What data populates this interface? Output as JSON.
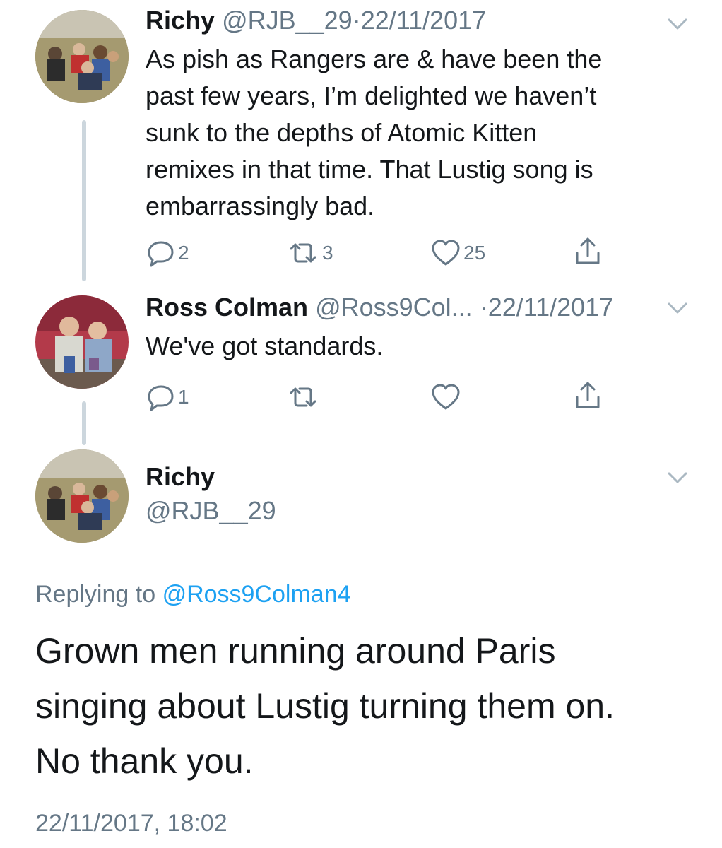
{
  "tweets": [
    {
      "name": "Richy",
      "handle": "@RJB__29",
      "separator": "·",
      "date": "22/11/2017",
      "lines": [
        "As pish as Rangers are & have been the",
        "past few years, I’m delighted we haven’t",
        "sunk to the depths of Atomic Kitten",
        "remixes in that time. That Lustig song is",
        "embarrassingly bad."
      ],
      "replies": "2",
      "retweets": "3",
      "likes": "25"
    },
    {
      "name": "Ross Colman",
      "handle": "@Ross9Col...",
      "separator": "·",
      "date": "22/11/2017",
      "lines": [
        "We've got standards."
      ],
      "replies": "1",
      "retweets": "",
      "likes": ""
    }
  ],
  "detail": {
    "name": "Richy",
    "handle": "@RJB__29",
    "replying_prefix": "Replying to",
    "replying_to": "@Ross9Colman4",
    "lines": [
      "Grown men running around Paris",
      "singing about Lustig turning them on.",
      "No thank you."
    ],
    "timestamp": "22/11/2017, 18:02"
  },
  "icons": {
    "reply": "reply-icon",
    "retweet": "retweet-icon",
    "like": "heart-icon",
    "share": "share-icon",
    "more": "chevron-down-icon"
  },
  "colors": {
    "text": "#14171a",
    "muted": "#657786",
    "link": "#1da1f2",
    "thread_line": "#ccd6dd"
  }
}
